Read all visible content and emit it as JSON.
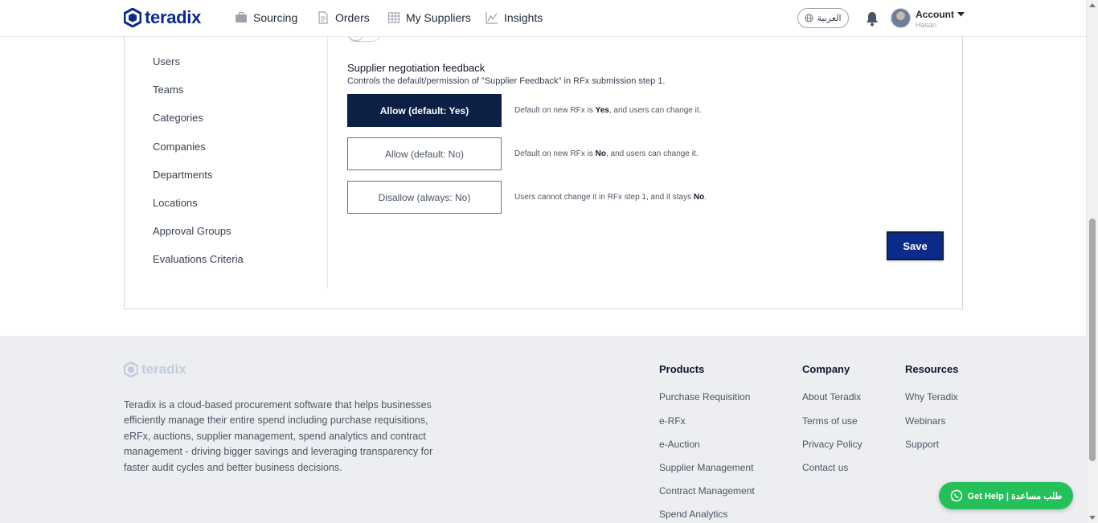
{
  "header": {
    "logo_text": "teradix",
    "nav": [
      {
        "label": "Sourcing",
        "icon": "briefcase-icon"
      },
      {
        "label": "Orders",
        "icon": "document-icon"
      },
      {
        "label": "My Suppliers",
        "icon": "building-icon"
      },
      {
        "label": "Insights",
        "icon": "chart-icon"
      }
    ],
    "language_label": "العربية",
    "account": {
      "label": "Account",
      "sub": "Hasan"
    }
  },
  "sidebar": {
    "items": [
      {
        "label": "Users"
      },
      {
        "label": "Teams"
      },
      {
        "label": "Categories"
      },
      {
        "label": "Companies"
      },
      {
        "label": "Departments"
      },
      {
        "label": "Locations"
      },
      {
        "label": "Approval Groups"
      },
      {
        "label": "Evaluations Criteria"
      }
    ]
  },
  "section": {
    "title": "Supplier negotiation feedback",
    "description": "Controls the default/permission of \"Supplier Feedback\" in RFx submission step 1.",
    "options": [
      {
        "label": "Allow (default: Yes)",
        "selected": true,
        "help_pre": "Default on new RFx is ",
        "help_bold": "Yes",
        "help_post": ", and users can change it."
      },
      {
        "label": "Allow (default: No)",
        "selected": false,
        "help_pre": "Default on new RFx is ",
        "help_bold": "No",
        "help_post": ", and users can change it."
      },
      {
        "label": "Disallow (always: No)",
        "selected": false,
        "help_pre": "Users cannot change it in RFx step 1, and it stays ",
        "help_bold": "No",
        "help_post": "."
      }
    ],
    "save_label": "Save"
  },
  "footer": {
    "logo_text": "teradix",
    "description": "Teradix is a cloud-based procurement software that helps businesses efficiently manage their entire spend including purchase requisitions, eRFx, auctions, supplier management, spend analytics and contract management - driving bigger savings and leveraging transparency for faster audit cycles and better business decisions.",
    "columns": [
      {
        "heading": "Products",
        "links": [
          "Purchase Requisition",
          "e-RFx",
          "e-Auction",
          "Supplier Management",
          "Contract Management",
          "Spend Analytics"
        ]
      },
      {
        "heading": "Company",
        "links": [
          "About Teradix",
          "Terms of use",
          "Privacy Policy",
          "Contact us"
        ]
      },
      {
        "heading": "Resources",
        "links": [
          "Why Teradix",
          "Webinars",
          "Support"
        ]
      }
    ]
  },
  "help_button": {
    "label": "Get Help | طلب مساعدة"
  },
  "colors": {
    "brand": "#0b2a8a",
    "selected_option": "#0c1f44",
    "help_green": "#25c05a",
    "footer_bg": "#eceef2"
  }
}
